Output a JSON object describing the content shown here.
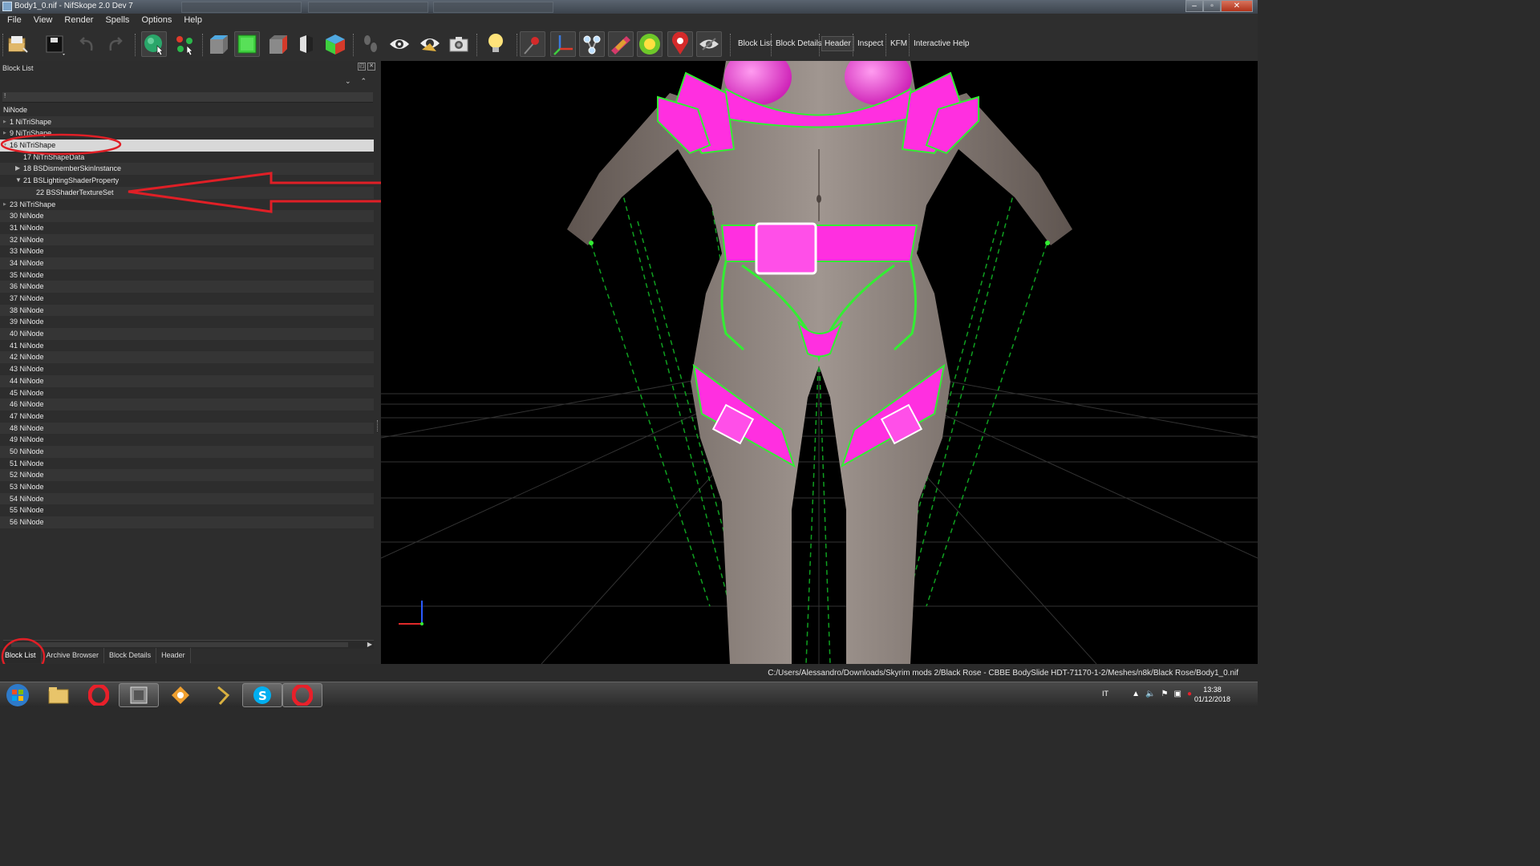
{
  "window": {
    "title": "Body1_0.nif - NifSkope 2.0 Dev 7"
  },
  "menu": [
    "File",
    "View",
    "Render",
    "Spells",
    "Options",
    "Help"
  ],
  "toolbar": {
    "icons": [
      "open-icon",
      "save-icon",
      "undo-icon",
      "redo-icon",
      "select-object-icon",
      "select-vertex-icon",
      "view-top-icon",
      "view-front-icon",
      "view-side-icon",
      "view-flip-icon",
      "view-user-icon",
      "walk-icon",
      "show-hidden-icon",
      "show-marker-icon",
      "screenshot-icon",
      "lighting-icon",
      "node-pin-icon",
      "axes-icon",
      "constraints-icon",
      "collision-icon",
      "light-sphere-icon",
      "location-icon",
      "visibility-icon"
    ],
    "links": [
      "Block List",
      "Block Details",
      "Header",
      "Inspect",
      "KFM",
      "Interactive Help"
    ],
    "active_link": "Header"
  },
  "block_list": {
    "title": "Block List",
    "filter_value": "!",
    "rows": [
      {
        "label": "NiNode",
        "depth": 0,
        "expander": "none"
      },
      {
        "label": "1 NiTriShape",
        "depth": 1,
        "expander": "collapsed"
      },
      {
        "label": "9 NiTriShape",
        "depth": 1,
        "expander": "collapsed"
      },
      {
        "label": "16 NiTriShape",
        "depth": 1,
        "expander": "expanded",
        "selected": true
      },
      {
        "label": "17 NiTriShapeData",
        "depth": 2,
        "expander": "none"
      },
      {
        "label": "18 BSDismemberSkinInstance",
        "depth": 2,
        "expander": "collapsed"
      },
      {
        "label": "21 BSLightingShaderProperty",
        "depth": 2,
        "expander": "expanded"
      },
      {
        "label": "22 BSShaderTextureSet",
        "depth": 3,
        "expander": "none"
      },
      {
        "label": "23 NiTriShape",
        "depth": 1,
        "expander": "collapsed"
      },
      {
        "label": "30 NiNode",
        "depth": 1,
        "expander": "none"
      },
      {
        "label": "31 NiNode",
        "depth": 1,
        "expander": "none"
      },
      {
        "label": "32 NiNode",
        "depth": 1,
        "expander": "none"
      },
      {
        "label": "33 NiNode",
        "depth": 1,
        "expander": "none"
      },
      {
        "label": "34 NiNode",
        "depth": 1,
        "expander": "none"
      },
      {
        "label": "35 NiNode",
        "depth": 1,
        "expander": "none"
      },
      {
        "label": "36 NiNode",
        "depth": 1,
        "expander": "none"
      },
      {
        "label": "37 NiNode",
        "depth": 1,
        "expander": "none"
      },
      {
        "label": "38 NiNode",
        "depth": 1,
        "expander": "none"
      },
      {
        "label": "39 NiNode",
        "depth": 1,
        "expander": "none"
      },
      {
        "label": "40 NiNode",
        "depth": 1,
        "expander": "none"
      },
      {
        "label": "41 NiNode",
        "depth": 1,
        "expander": "none"
      },
      {
        "label": "42 NiNode",
        "depth": 1,
        "expander": "none"
      },
      {
        "label": "43 NiNode",
        "depth": 1,
        "expander": "none"
      },
      {
        "label": "44 NiNode",
        "depth": 1,
        "expander": "none"
      },
      {
        "label": "45 NiNode",
        "depth": 1,
        "expander": "none"
      },
      {
        "label": "46 NiNode",
        "depth": 1,
        "expander": "none"
      },
      {
        "label": "47 NiNode",
        "depth": 1,
        "expander": "none"
      },
      {
        "label": "48 NiNode",
        "depth": 1,
        "expander": "none"
      },
      {
        "label": "49 NiNode",
        "depth": 1,
        "expander": "none"
      },
      {
        "label": "50 NiNode",
        "depth": 1,
        "expander": "none"
      },
      {
        "label": "51 NiNode",
        "depth": 1,
        "expander": "none"
      },
      {
        "label": "52 NiNode",
        "depth": 1,
        "expander": "none"
      },
      {
        "label": "53 NiNode",
        "depth": 1,
        "expander": "none"
      },
      {
        "label": "54 NiNode",
        "depth": 1,
        "expander": "none"
      },
      {
        "label": "55 NiNode",
        "depth": 1,
        "expander": "none"
      },
      {
        "label": "56 NiNode",
        "depth": 1,
        "expander": "none"
      }
    ]
  },
  "bottom_tabs": [
    "Block List",
    "Archive Browser",
    "Block Details",
    "Header"
  ],
  "active_bottom_tab": "Block List",
  "status": {
    "path": "C:/Users/Alessandro/Downloads/Skyrim mods 2/Black Rose - CBBE BodySlide HDT-71170-1-2/Meshes/n8k/Black Rose/Body1_0.nif"
  },
  "taskbar": {
    "apps": [
      "start-icon",
      "file-explorer-icon",
      "opera-icon",
      "nifskope-icon",
      "bodyslide-icon",
      "winamp-icon",
      "skype-icon",
      "opera-icon"
    ],
    "language": "IT",
    "time": "13:38",
    "date": "01/12/2018"
  },
  "colors": {
    "highlight": "#e01f26",
    "wire": "#33ee33",
    "armor": "#ff2fe0",
    "skin": "#8c7f79"
  }
}
